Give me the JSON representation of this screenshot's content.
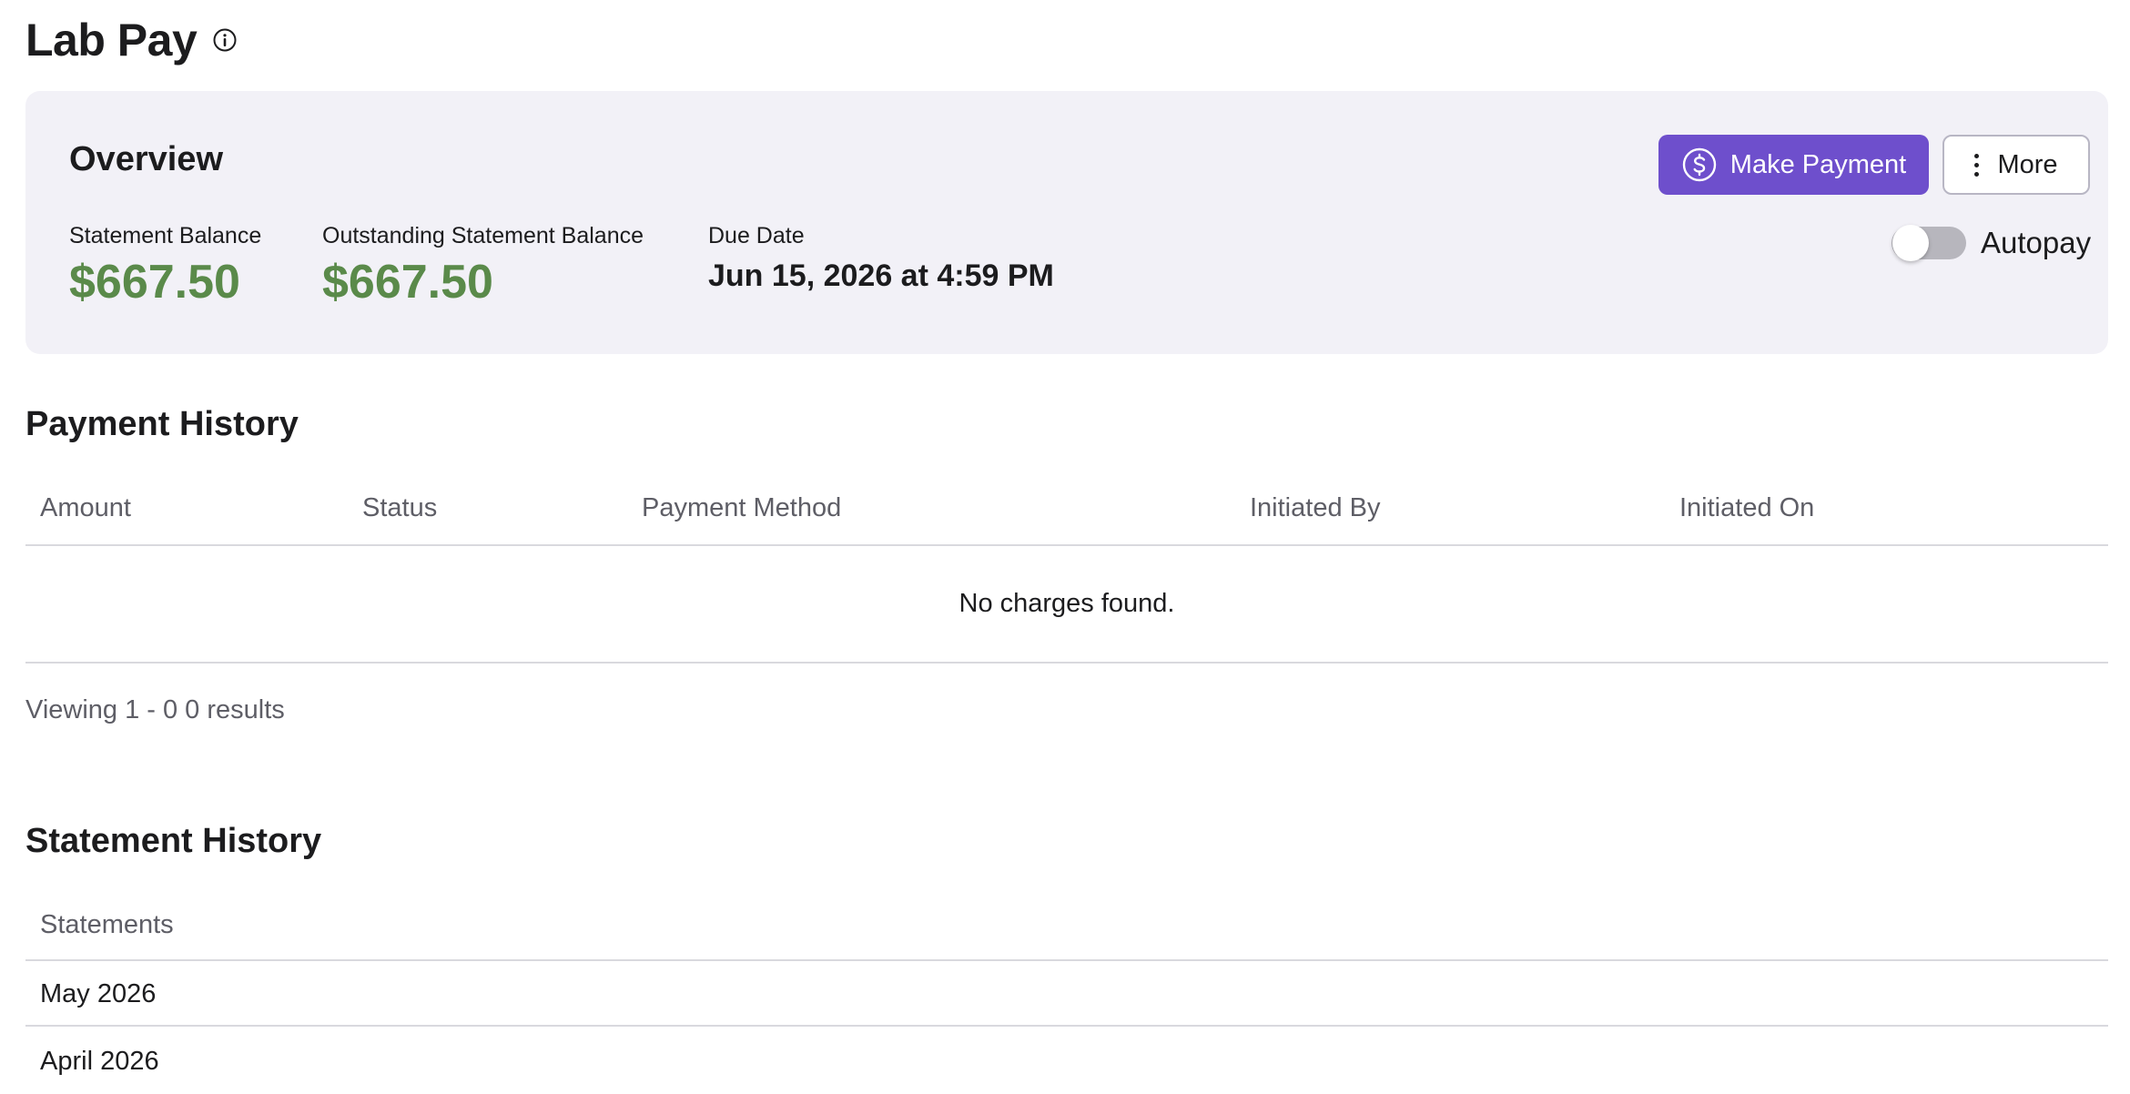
{
  "page": {
    "title": "Lab Pay",
    "info_icon": "info-circle-icon"
  },
  "overview": {
    "title": "Overview",
    "make_payment_label": "Make Payment",
    "make_payment_icon": "dollar-circle-icon",
    "more_label": "More",
    "more_icon": "vertical-ellipsis-icon",
    "autopay_label": "Autopay",
    "autopay_enabled": false,
    "metrics": {
      "statement_balance": {
        "label": "Statement Balance",
        "value": "$667.50"
      },
      "outstanding_balance": {
        "label": "Outstanding Statement Balance",
        "value": "$667.50"
      },
      "due_date": {
        "label": "Due Date",
        "value": "Jun 15, 2026 at 4:59 PM"
      }
    }
  },
  "payment_history": {
    "title": "Payment History",
    "columns": [
      "Amount",
      "Status",
      "Payment Method",
      "Initiated By",
      "Initiated On"
    ],
    "empty_message": "No charges found.",
    "results_text": "Viewing 1 - 0 0 results"
  },
  "statement_history": {
    "title": "Statement History",
    "column": "Statements",
    "rows": [
      "May 2026",
      "April 2026"
    ]
  },
  "colors": {
    "accent": "#6e4fcc",
    "balance_green": "#5a8a4a",
    "card_background": "#f2f1f7"
  }
}
